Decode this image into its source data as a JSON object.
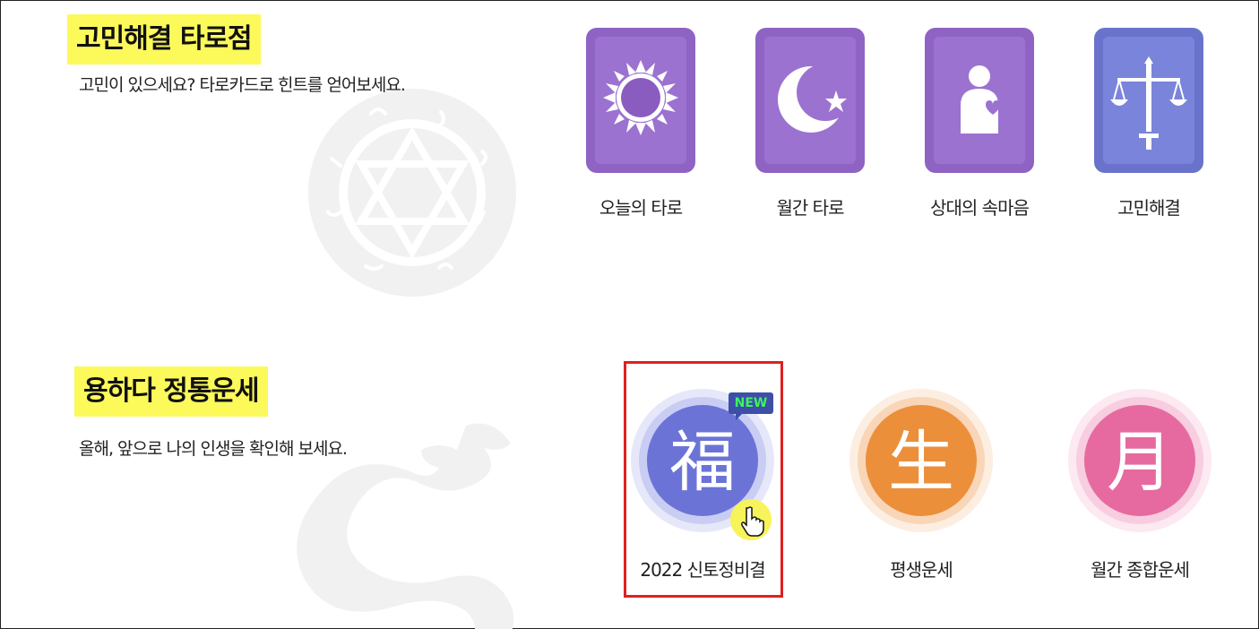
{
  "tarot": {
    "title": "고민해결 타로점",
    "subtitle": "고민이 있으세요? 타로카드로 힌트를 얻어보세요.",
    "cards": [
      {
        "label": "오늘의 타로",
        "icon": "sun-icon"
      },
      {
        "label": "월간 타로",
        "icon": "moon-star-icon"
      },
      {
        "label": "상대의 속마음",
        "icon": "person-heart-icon"
      },
      {
        "label": "고민해결",
        "icon": "scales-sword-icon"
      }
    ]
  },
  "fortune": {
    "title": "용하다 정통운세",
    "subtitle": "올해, 앞으로 나의 인생을 확인해 보세요.",
    "badge": "NEW",
    "items": [
      {
        "label": "2022 신토정비결",
        "char": "福",
        "color": "#6b74d6"
      },
      {
        "label": "평생운세",
        "char": "生",
        "color": "#ec8f3a"
      },
      {
        "label": "월간 종합운세",
        "char": "月",
        "color": "#e66aa0"
      }
    ]
  }
}
